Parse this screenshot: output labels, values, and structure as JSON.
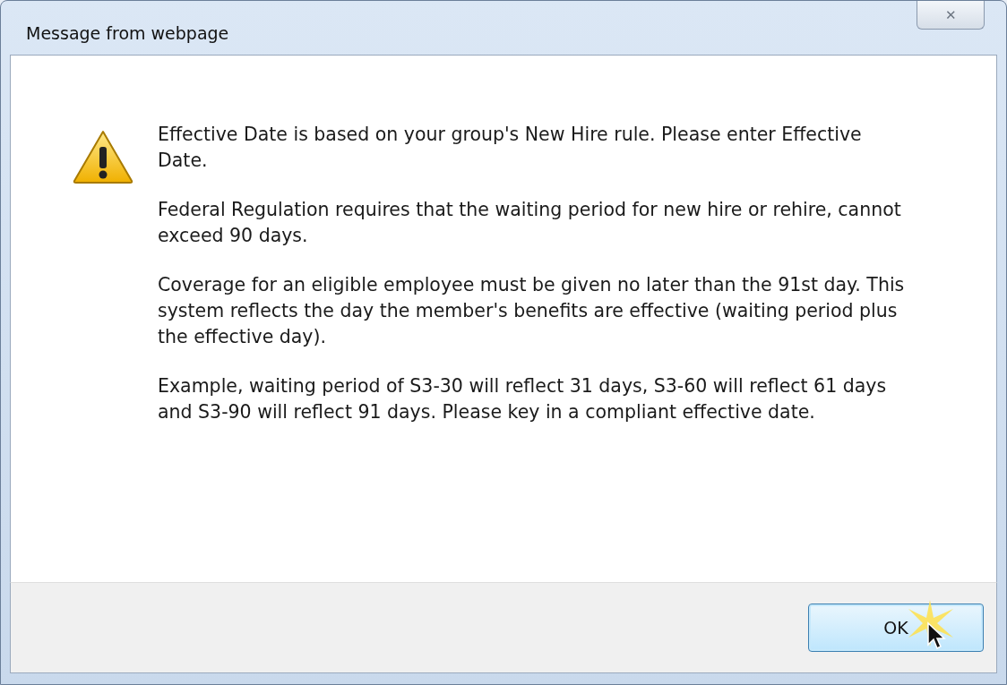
{
  "window": {
    "title": "Message from webpage",
    "close_label": "✕"
  },
  "message": {
    "paragraphs": [
      "Effective Date is based on your group's New Hire rule. Please enter Effective Date.",
      "Federal Regulation requires that the waiting period for new hire or rehire, cannot exceed 90 days.",
      "Coverage for an eligible employee must be given no later than the 91st day. This system reflects the day the member's benefits are effective (waiting period plus the effective day).",
      "Example, waiting period of S3-30 will reflect 31 days, S3-60 will reflect 61 days and S3-90 will reflect 91 days. Please key in a compliant effective date."
    ]
  },
  "buttons": [
    {
      "label": "OK",
      "focused": true
    }
  ]
}
